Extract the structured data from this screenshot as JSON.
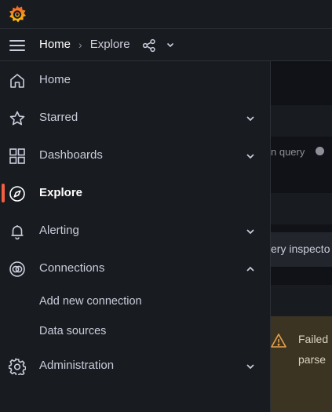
{
  "colors": {
    "background": "#181b1f",
    "accent": "#f55f3e",
    "text": "#ccccdc",
    "active_text": "#ffffff"
  },
  "breadcrumb": {
    "home": "Home",
    "separator": "›",
    "current": "Explore"
  },
  "menu": {
    "items": [
      {
        "label": "Home",
        "icon": "home-icon",
        "expandable": false
      },
      {
        "label": "Starred",
        "icon": "star-icon",
        "expandable": true,
        "expanded": false
      },
      {
        "label": "Dashboards",
        "icon": "dashboards-icon",
        "expandable": true,
        "expanded": false
      },
      {
        "label": "Explore",
        "icon": "compass-icon",
        "expandable": false,
        "active": true
      },
      {
        "label": "Alerting",
        "icon": "bell-icon",
        "expandable": true,
        "expanded": false
      },
      {
        "label": "Connections",
        "icon": "connections-icon",
        "expandable": true,
        "expanded": true
      },
      {
        "label": "Administration",
        "icon": "gear-icon",
        "expandable": true,
        "expanded": false
      }
    ],
    "connections_children": [
      "Add new connection",
      "Data sources"
    ]
  },
  "background": {
    "query_label": "n query",
    "inspector_button": "ery inspecto",
    "warning_line1": "Failed",
    "warning_line2": "parse"
  }
}
